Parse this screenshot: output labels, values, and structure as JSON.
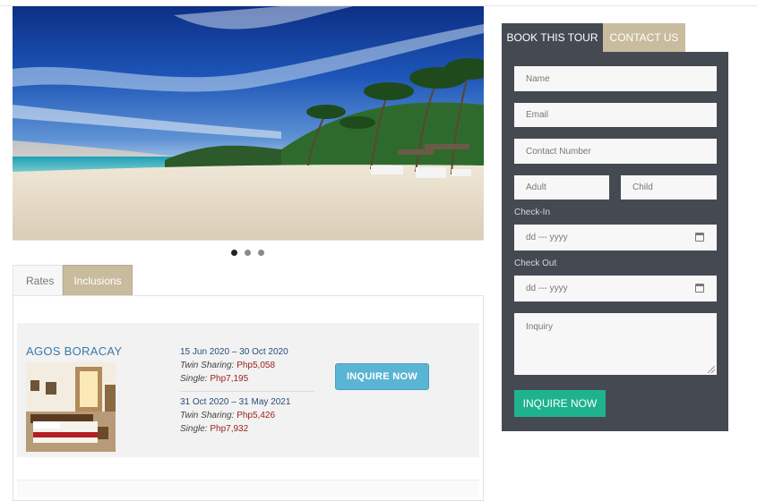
{
  "gallery": {
    "image": "beach-photo",
    "slide_count": 3,
    "active_slide": 1
  },
  "tabs": {
    "rates": "Rates",
    "inclusions": "Inclusions"
  },
  "rates": {
    "hotel_name": "AGOS BORACAY",
    "periods": [
      {
        "range": "15 Jun 2020 – 30 Oct 2020",
        "twin_label": "Twin Sharing:",
        "twin_price": "Php5,058",
        "single_label": "Single:",
        "single_price": "Php7,195"
      },
      {
        "range": "31 Oct 2020 – 31 May 2021",
        "twin_label": "Twin Sharing:",
        "twin_price": "Php5,426",
        "single_label": "Single:",
        "single_price": "Php7,932"
      }
    ],
    "inquire_label": "INQUIRE NOW"
  },
  "booking": {
    "tab_book": "BOOK THIS TOUR",
    "tab_contact": "CONTACT US",
    "name_placeholder": "Name",
    "email_placeholder": "Email",
    "contact_placeholder": "Contact Number",
    "adult_placeholder": "Adult",
    "child_placeholder": "Child",
    "checkin_label": "Check-In",
    "checkin_value": "dd --- yyyy",
    "checkout_label": "Check Out",
    "checkout_value": "dd --- yyyy",
    "inquiry_placeholder": "Inquiry",
    "submit_label": "INQUIRE NOW"
  },
  "colors": {
    "form_bg": "#454a52",
    "tab_accent": "#c9bb9e",
    "inquire_button": "#5ab4d4",
    "submit_button": "#1fb28e",
    "hotel_name": "#3a7aa8",
    "price": "#9a2222"
  }
}
